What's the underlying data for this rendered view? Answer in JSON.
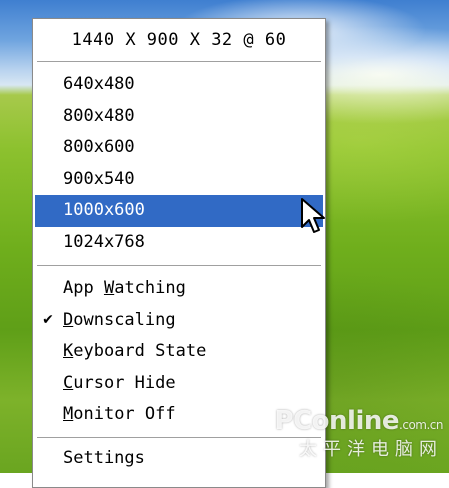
{
  "menu": {
    "header": "1440 X 900 X 32 @ 60",
    "resolutions": [
      {
        "label": "640x480",
        "highlighted": false
      },
      {
        "label": "800x480",
        "highlighted": false
      },
      {
        "label": "800x600",
        "highlighted": false
      },
      {
        "label": "900x540",
        "highlighted": false
      },
      {
        "label": "1000x600",
        "highlighted": true
      },
      {
        "label": "1024x768",
        "highlighted": false
      }
    ],
    "options": [
      {
        "pre": "App ",
        "key": "W",
        "post": "atching",
        "checked": false
      },
      {
        "pre": "",
        "key": "D",
        "post": "ownscaling",
        "checked": true
      },
      {
        "pre": "",
        "key": "K",
        "post": "eyboard State",
        "checked": false
      },
      {
        "pre": "",
        "key": "C",
        "post": "ursor Hide",
        "checked": false
      },
      {
        "pre": "",
        "key": "M",
        "post": "onitor Off",
        "checked": false
      }
    ],
    "tail": {
      "label": "Settings"
    },
    "check_glyph": "✔",
    "highlight_color": "#316ac5"
  },
  "watermark": {
    "brand": "PConline",
    "domain": ".com.cn",
    "chinese": "太平洋电脑网"
  },
  "icons": {
    "cursor": "arrow-cursor-icon",
    "check": "checkmark-icon"
  }
}
